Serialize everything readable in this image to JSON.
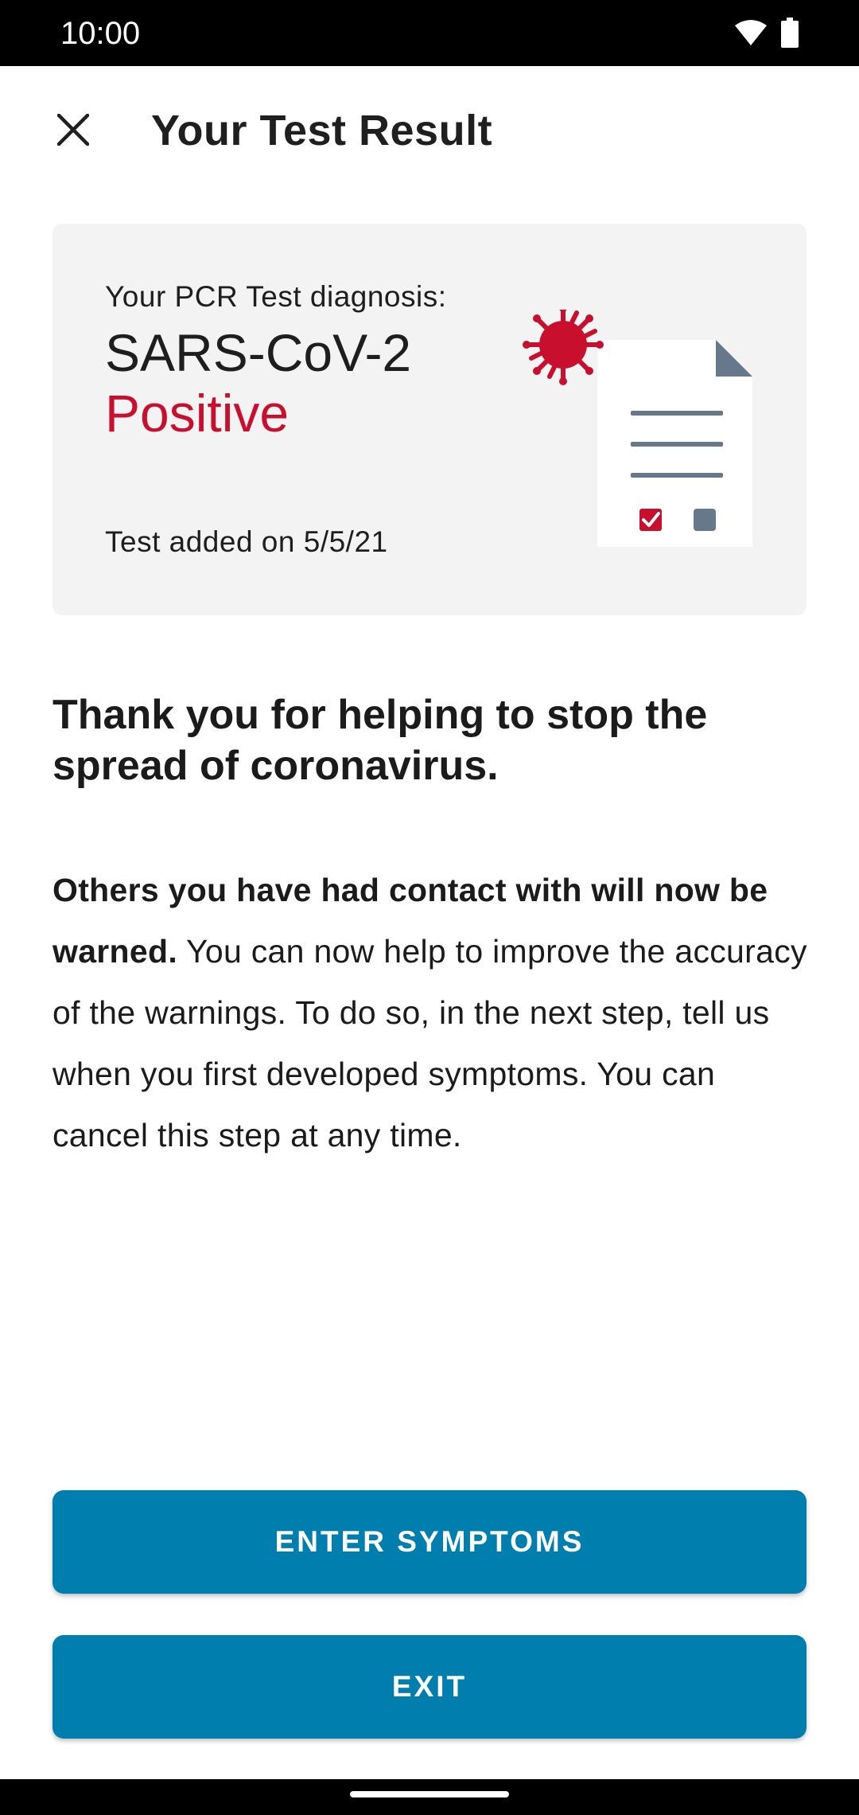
{
  "status_bar": {
    "time": "10:00",
    "icons": [
      "wifi-icon",
      "battery-icon"
    ]
  },
  "app_bar": {
    "title": "Your Test Result",
    "close_icon": "close-icon"
  },
  "result_card": {
    "label": "Your PCR Test diagnosis:",
    "diagnosis": "SARS-CoV-2",
    "result": "Positive",
    "date_text": "Test added on 5/5/21",
    "illustration_icon": "virus-document-icon"
  },
  "heading": "Thank you for helping to stop the spread of coronavirus.",
  "body": {
    "bold": "Others you have had contact with will now be warned.",
    "text": " You can now help to improve the accuracy of the warnings. To do so, in the next step, tell us when you first developed symptoms. You can cancel this step at any time."
  },
  "buttons": {
    "enter_symptoms": "ENTER SYMPTOMS",
    "exit": "EXIT"
  },
  "colors": {
    "accent": "#007fae",
    "positive": "#c8102e",
    "card_bg": "#f3f3f3"
  }
}
